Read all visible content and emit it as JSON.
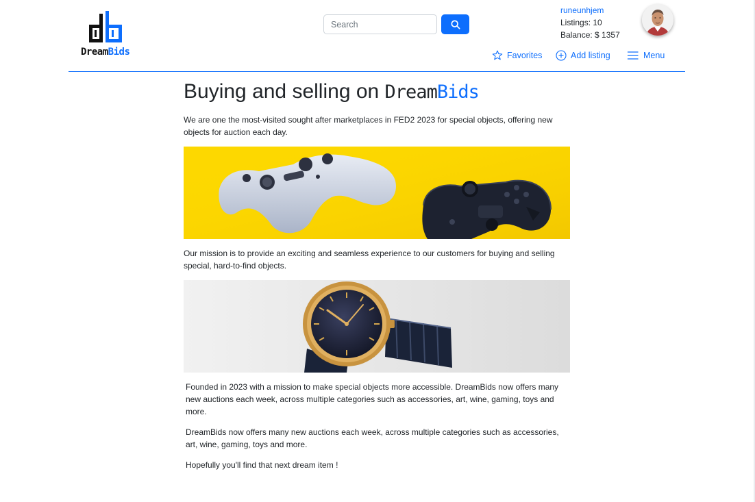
{
  "header": {
    "logo": {
      "text_dark": "Dream",
      "text_accent": "Bids",
      "mark": "db"
    },
    "search": {
      "placeholder": "Search",
      "icon": "search-icon"
    },
    "user": {
      "name": "runeunhjem",
      "listings": "Listings: 10",
      "balance": "Balance: $ 1357"
    },
    "nav": [
      {
        "label": "Favorites",
        "icon": "star-icon"
      },
      {
        "label": "Add listing",
        "icon": "plus-circle-icon"
      },
      {
        "label": "Menu",
        "icon": "hamburger-icon"
      }
    ]
  },
  "main": {
    "title": "Buying and selling on ",
    "title_brand_dark": "Dream",
    "title_brand_accent": "Bids",
    "intro": "We are one the most-visited sought after marketplaces in FED2 2023 for special objects, offering new objects for auction each day.",
    "mission": "Our mission is to provide an exciting and seamless experience to our customers for buying and selling special, hard-to-find objects.",
    "founded": "Founded in 2023 with a mission to make special objects more accessible. DreamBids now offers many new auctions each week, across multiple categories such as accessories, art, wine, gaming, toys and more.",
    "offers": "DreamBids now offers many new auctions each week, across multiple categories such as accessories, art, wine, gaming, toys and more.",
    "closing": "Hopefully you'll find that next dream item !"
  },
  "colors": {
    "accent": "#0d6efd",
    "text": "#212529",
    "banner_yellow": "#fdd800",
    "banner_gray": "#e6e6e6"
  }
}
